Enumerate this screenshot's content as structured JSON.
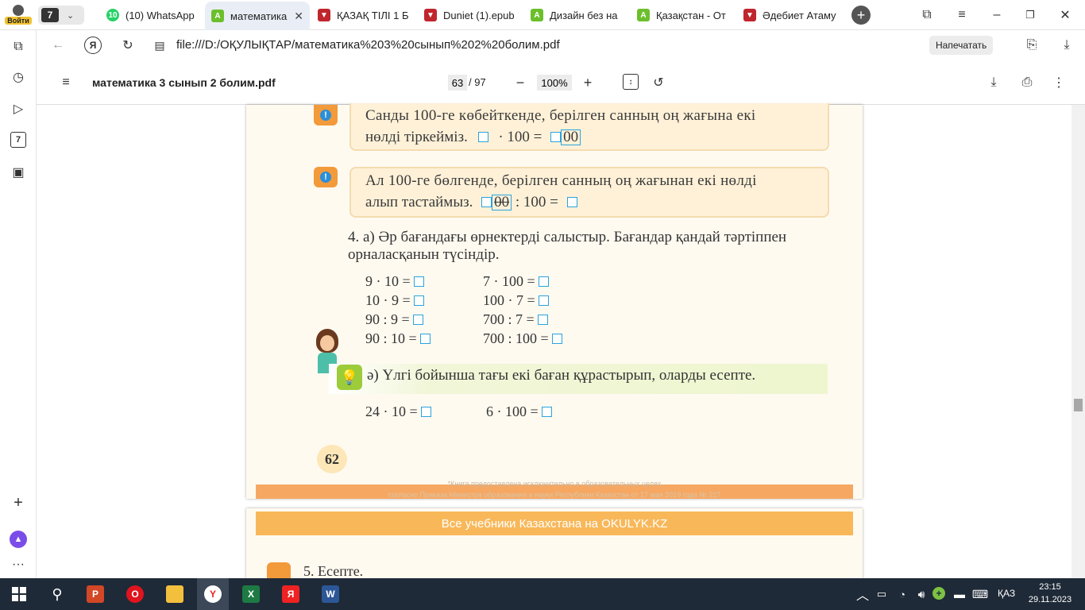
{
  "taskbar_top": {
    "login_label": "Войти",
    "tab_count": "7"
  },
  "tabs": [
    {
      "title": "(10) WhatsApp",
      "badge": "10"
    },
    {
      "title": "математика"
    },
    {
      "title": "ҚАЗАҚ ТІЛІ 1 Б"
    },
    {
      "title": "Duniet (1).epub"
    },
    {
      "title": "Дизайн без на"
    },
    {
      "title": "Қазақстан - От"
    },
    {
      "title": "Әдебиет Атаму"
    }
  ],
  "address": {
    "url": "file:///D:/ОҚУЛЫҚТАР/математика%203%20сынып%202%20болим.pdf",
    "print_label": "Напечатать"
  },
  "sidebar": {
    "badge": "7"
  },
  "pdf": {
    "filename": "математика 3 сынып 2 болим.pdf",
    "page_current": "63",
    "page_total": "/ 97",
    "zoom": "100%"
  },
  "book": {
    "note1_line1": "Санды 100-ге көбейткенде, берілген санның оң жағына екі",
    "note1_line2": "нөлді тіркейміз.",
    "note1_expr": "· 100 =",
    "note1_zeros": "00",
    "note2_line1": "Ал 100-ге бөлгенде, берілген санның оң жағынан екі нөлді",
    "note2_line2": "алып тастаймыз.",
    "note2_zeros": "00",
    "note2_expr": ": 100 =",
    "task4_line1": "4. а) Әр бағандағы өрнектерді салыстыр. Бағандар қандай тәртіппен",
    "task4_line2": "орналасқанын түсіндір.",
    "col1": [
      "9 · 10 =",
      "10 · 9 =",
      "90 : 9 =",
      "90 : 10 ="
    ],
    "col2": [
      "7 · 100 =",
      "100 · 7 =",
      "700 : 7 =",
      "700 : 100 ="
    ],
    "task_b": "ә) Үлгі бойынша тағы екі баған құрастырып, оларды есепте.",
    "sample1": "24 · 10 =",
    "sample2": "6 · 100 =",
    "page_number": "62",
    "footer1": "*Книга предоставлена исключительно в образовательных целях",
    "footer2": "согласно Приказа Министра образования и науки Республики Казахстан от 17 мая 2019 года № 217",
    "banner": "Все учебники Казахстана на OKULYK.KZ",
    "task5": "5. Есепте."
  },
  "system": {
    "lang": "ҚАЗ",
    "time": "23:15",
    "date": "29.11.2023"
  },
  "colors": {
    "accent": "#f39a3b",
    "book_bg": "#fffaf0",
    "banner": "#f8b85a",
    "note_bg": "#fff1d8"
  }
}
